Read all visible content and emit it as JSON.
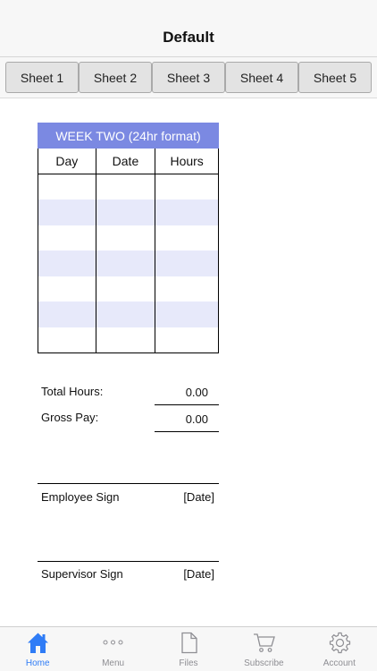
{
  "nav": {
    "title": "Default"
  },
  "sheets": [
    "Sheet 1",
    "Sheet 2",
    "Sheet 3",
    "Sheet 4",
    "Sheet 5"
  ],
  "timesheet": {
    "header": "WEEK TWO (24hr format)",
    "columns": [
      "Day",
      "Date",
      "Hours"
    ],
    "rows": [
      [
        "",
        "",
        ""
      ],
      [
        "",
        "",
        ""
      ],
      [
        "",
        "",
        ""
      ],
      [
        "",
        "",
        ""
      ],
      [
        "",
        "",
        ""
      ],
      [
        "",
        "",
        ""
      ],
      [
        "",
        "",
        ""
      ]
    ]
  },
  "summary": {
    "total_hours_label": "Total Hours:",
    "total_hours_value": "0.00",
    "gross_pay_label": "Gross Pay:",
    "gross_pay_value": "0.00"
  },
  "signatures": {
    "employee_label": "Employee Sign",
    "employee_date": "[Date]",
    "supervisor_label": "Supervisor Sign",
    "supervisor_date": "[Date]"
  },
  "tabbar": {
    "active": "Home",
    "items": [
      {
        "label": "Home",
        "icon": "home-icon"
      },
      {
        "label": "Menu",
        "icon": "more-icon"
      },
      {
        "label": "Files",
        "icon": "document-icon"
      },
      {
        "label": "Subscribe",
        "icon": "cart-icon"
      },
      {
        "label": "Account",
        "icon": "gear-icon"
      }
    ]
  },
  "colors": {
    "accent": "#2f7cf6",
    "header_bg": "#7b89e2",
    "row_alt": "#e7e9fa"
  }
}
